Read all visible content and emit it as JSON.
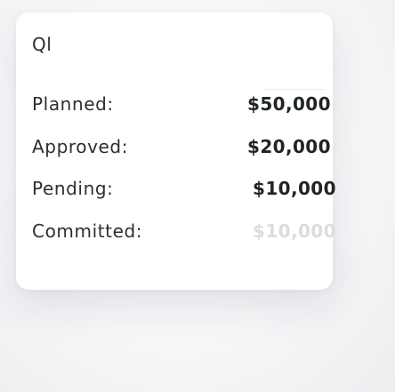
{
  "card": {
    "title": "Ql",
    "rows": [
      {
        "label": "Planned:",
        "value": "$50,000"
      },
      {
        "label": "Approved:",
        "value": "$20,000"
      },
      {
        "label": "Pending:",
        "value": "$10,000"
      },
      {
        "label": "Committed:",
        "value": "$10,000"
      }
    ]
  },
  "colors": {
    "text": "#2b2f33",
    "value": "#1f2427",
    "muted_value": "#dcdcdc",
    "card_background": "#ffffff"
  }
}
